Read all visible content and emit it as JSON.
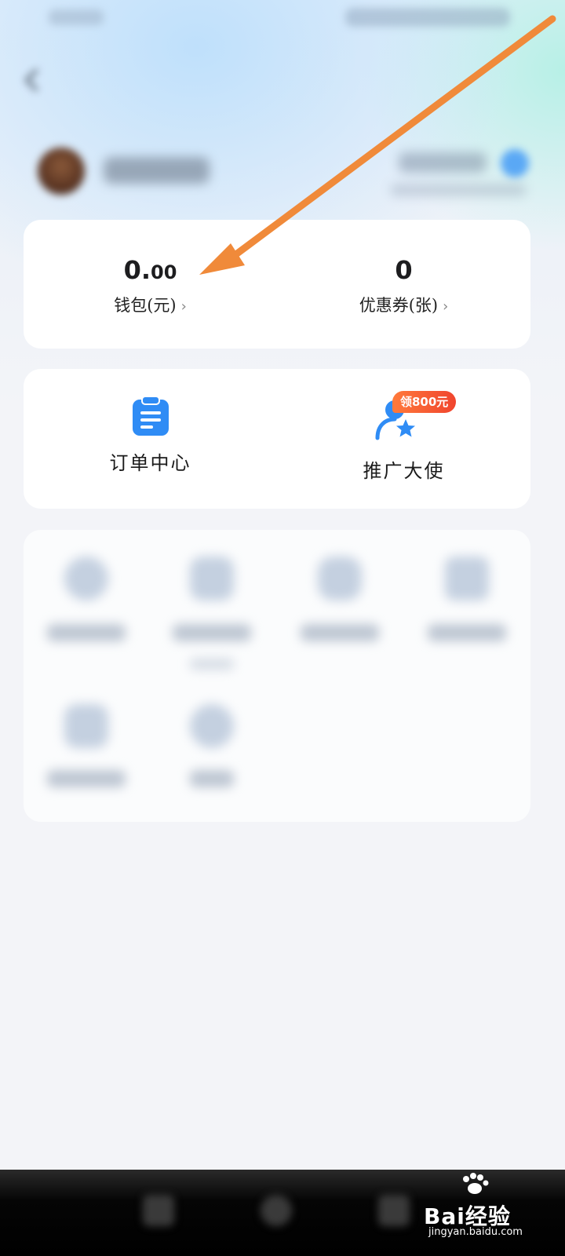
{
  "wallet": {
    "balance_int": "0.",
    "balance_dec": "00",
    "balance_label": "钱包(元)",
    "coupons_value": "0",
    "coupons_label": "优惠券(张)"
  },
  "functions": {
    "orders_label": "订单中心",
    "promo_label": "推广大使",
    "promo_badge": "领800元"
  },
  "icons": {
    "back": "chevron-left-icon",
    "orders": "clipboard-icon",
    "promo": "person-star-icon",
    "chevron": "chevron-right-icon"
  },
  "watermark": {
    "brand": "Bai经验",
    "url": "jingyan.baidu.com"
  },
  "colors": {
    "accent_blue": "#2f8cf5",
    "badge_orange": "#f0452e",
    "annotation_arrow": "#f08a3a"
  }
}
